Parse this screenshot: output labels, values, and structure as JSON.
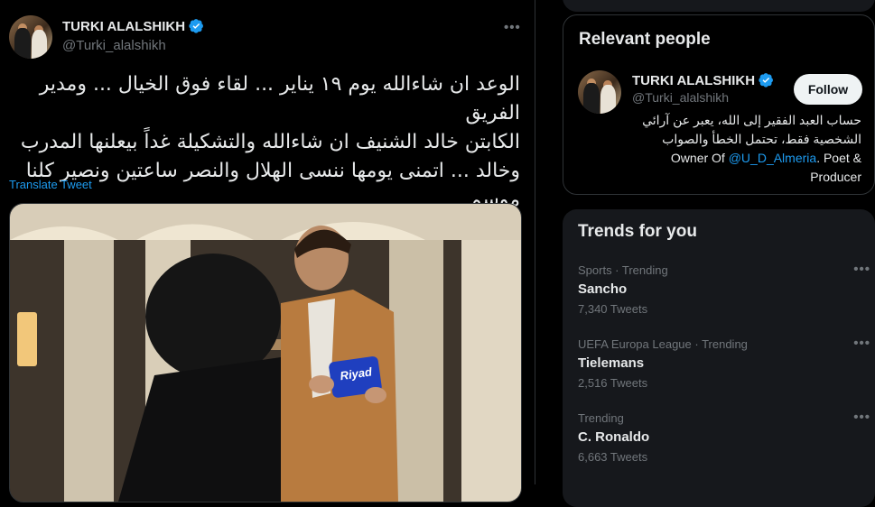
{
  "tweet": {
    "author_name": "TURKI ALALSHIKH",
    "author_handle": "@Turki_alalshikh",
    "more_icon": "•••",
    "text": "الوعد ان شاءالله يوم ١٩ يناير ... لقاء فوق الخيال ... ومدير الفريق\nالكابتن خالد الشنيف ان شاءالله والتشكيلة غداً بيعلنها المدرب\nوخالد ... اتمنى يومها ننسى الهلال والنصر ساعتين ونصير كلنا موسم\nالرياض... وبعد الساعتين نوقف الهدنة 😂🇸🇦❤️",
    "translate_label": "Translate Tweet",
    "media": {
      "armband_text": "Riyad"
    }
  },
  "relevant_people": {
    "title": "Relevant people",
    "person": {
      "name": "TURKI ALALSHIKH",
      "handle": "@Turki_alalshikh",
      "follow_label": "Follow",
      "bio_line1": "حساب العبد الفقير إلى الله، يعبر عن آرائي",
      "bio_line2": "الشخصية فقط، تحتمل الخطأ والصواب",
      "bio_line3_prefix": "Owner Of ",
      "bio_line3_link": "@U_D_Almeria",
      "bio_line3_suffix": ". Poet &",
      "bio_line4": "Producer"
    }
  },
  "trends": {
    "title": "Trends for you",
    "items": [
      {
        "meta": "Sports · Trending",
        "name": "Sancho",
        "count": "7,340 Tweets"
      },
      {
        "meta": "UEFA Europa League · Trending",
        "name": "Tielemans",
        "count": "2,516 Tweets"
      },
      {
        "meta": "Trending",
        "name": "C. Ronaldo",
        "count": "6,663 Tweets"
      }
    ]
  },
  "colors": {
    "accent": "#1d9bf0",
    "background": "#000000",
    "card": "#16181c",
    "muted": "#71767b"
  },
  "icons": [
    "verified-badge-icon",
    "more-icon"
  ]
}
